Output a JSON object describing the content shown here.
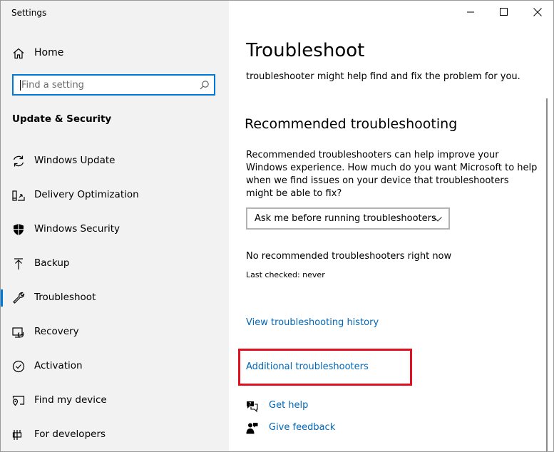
{
  "window": {
    "title": "Settings",
    "controls": [
      "minimize",
      "maximize",
      "close"
    ]
  },
  "sidebar": {
    "home_label": "Home",
    "search_placeholder": "Find a setting",
    "section_title": "Update & Security",
    "items": [
      {
        "label": "Windows Update",
        "icon": "refresh-icon"
      },
      {
        "label": "Delivery Optimization",
        "icon": "delivery-optimization-icon"
      },
      {
        "label": "Windows Security",
        "icon": "shield-icon"
      },
      {
        "label": "Backup",
        "icon": "backup-arrow-icon"
      },
      {
        "label": "Troubleshoot",
        "icon": "wrench-icon",
        "active": true
      },
      {
        "label": "Recovery",
        "icon": "recovery-icon"
      },
      {
        "label": "Activation",
        "icon": "check-circle-icon"
      },
      {
        "label": "Find my device",
        "icon": "find-device-icon"
      },
      {
        "label": "For developers",
        "icon": "developer-icon"
      }
    ]
  },
  "main": {
    "title": "Troubleshoot",
    "intro": "troubleshooter might help find and fix the problem for you.",
    "recommended_heading": "Recommended troubleshooting",
    "recommended_description": "Recommended troubleshooters can help improve your Windows experience. How much do you want Microsoft to help when we find issues on your device that troubleshooters might be able to fix?",
    "dropdown_value": "Ask me before running troubleshooters",
    "status": "No recommended troubleshooters right now",
    "last_checked": "Last checked: never",
    "history_link": "View troubleshooting history",
    "additional_link": "Additional troubleshooters",
    "get_help": "Get help",
    "give_feedback": "Give feedback"
  },
  "colors": {
    "accent": "#0078d7",
    "link": "#0067b8",
    "highlight": "#e0101e",
    "sidebar_bg": "#f2f2f2"
  }
}
